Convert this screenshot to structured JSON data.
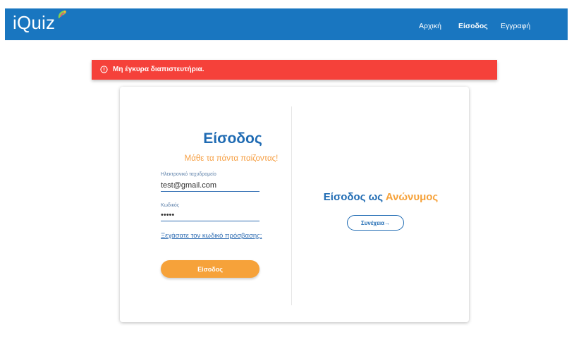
{
  "navbar": {
    "brand": "iQuiz",
    "links": [
      {
        "label": "Αρχική"
      },
      {
        "label": "Είσοδος"
      },
      {
        "label": "Εγγραφή"
      }
    ]
  },
  "alert": {
    "icon": "alert-circle-icon",
    "message": "Μη έγκυρα διαπιστευτήρια."
  },
  "login": {
    "title": "Είσοδος",
    "subtitle": "Μάθε τα πάντα παίζοντας!",
    "email_label": "Ηλεκτρονικό ταχυδρομείο",
    "email_value": "test@gmail.com",
    "password_label": "Κωδικός",
    "password_value": "•••••",
    "forgot_link": "Ξεχάσατε τον κωδικό πρόσβασης;",
    "submit_label": "Είσοδος"
  },
  "anonymous": {
    "title_part1": "Είσοδος ως",
    "title_part2": "Ανώνυμος",
    "continue_label": "Συνέχεια→"
  },
  "colors": {
    "nav": "#1976c0",
    "alert": "#f5413a",
    "primary": "#1f6bb3",
    "accent": "#f6a23a"
  }
}
